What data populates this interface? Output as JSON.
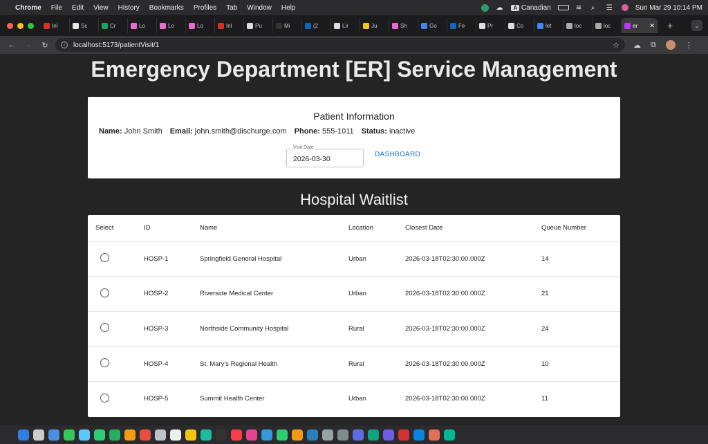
{
  "menubar": {
    "app": "Chrome",
    "items": [
      "File",
      "Edit",
      "View",
      "History",
      "Bookmarks",
      "Profiles",
      "Tab",
      "Window",
      "Help"
    ],
    "keyboard": "Canadian",
    "clock": "Sun Mar 29  10:14 PM"
  },
  "tabs": [
    {
      "label": "Inl",
      "color": "#d93025"
    },
    {
      "label": "Sc",
      "color": "#e8e8e8"
    },
    {
      "label": "Cr",
      "color": "#1aa260"
    },
    {
      "label": "Lo",
      "color": "#e96ad0"
    },
    {
      "label": "Lo",
      "color": "#e96ad0"
    },
    {
      "label": "Lo",
      "color": "#e96ad0"
    },
    {
      "label": "Inl",
      "color": "#d93025"
    },
    {
      "label": "Pu",
      "color": "#dddddd"
    },
    {
      "label": "Mi",
      "color": "#333333"
    },
    {
      "label": "(2",
      "color": "#0a66c2"
    },
    {
      "label": "Lir",
      "color": "#dddddd"
    },
    {
      "label": "Ju",
      "color": "#f5c518"
    },
    {
      "label": "Sh",
      "color": "#e96ad0"
    },
    {
      "label": "Go",
      "color": "#4285f4"
    },
    {
      "label": "Fe",
      "color": "#0a66c2"
    },
    {
      "label": "Pr",
      "color": "#dddddd"
    },
    {
      "label": "Co",
      "color": "#dddddd"
    },
    {
      "label": "let",
      "color": "#4285f4"
    },
    {
      "label": "loc",
      "color": "#aaaaaa"
    },
    {
      "label": "loc",
      "color": "#aaaaaa"
    }
  ],
  "active_tab": {
    "label": "er",
    "color": "#bd34fe"
  },
  "address": {
    "url": "localhost:5173/patientVisit/1"
  },
  "page": {
    "title": "Emergency Department [ER] Service Management",
    "patient": {
      "heading": "Patient Information",
      "name_label": "Name:",
      "name": "John Smith",
      "email_label": "Email:",
      "email": "john.smith@dischurge.com",
      "phone_label": "Phone:",
      "phone": "555-1011",
      "status_label": "Status:",
      "status": "inactive",
      "visit_date_label": "Visit Date",
      "visit_date": "2026-03-30",
      "dashboard_link": "DASHBOARD"
    },
    "waitlist_title": "Hospital Waitlist",
    "table": {
      "columns": [
        "Select",
        "ID",
        "Name",
        "Location",
        "Closest Date",
        "Queue Number"
      ],
      "rows": [
        {
          "id": "HOSP-1",
          "name": "Springfield General Hospital",
          "location": "Urban",
          "date": "2026-03-18T02:30:00.000Z",
          "queue": "14"
        },
        {
          "id": "HOSP-2",
          "name": "Riverside Medical Center",
          "location": "Urban",
          "date": "2026-03-18T02:30:00.000Z",
          "queue": "21"
        },
        {
          "id": "HOSP-3",
          "name": "Northside Community Hospital",
          "location": "Rural",
          "date": "2026-03-18T02:30:00.000Z",
          "queue": "24"
        },
        {
          "id": "HOSP-4",
          "name": "St. Mary's Regional Health",
          "location": "Rural",
          "date": "2026-03-18T02:30:00.000Z",
          "queue": "10"
        },
        {
          "id": "HOSP-5",
          "name": "Summit Health Center",
          "location": "Urban",
          "date": "2026-03-18T02:30:00.000Z",
          "queue": "11"
        }
      ]
    }
  },
  "colors": {
    "link": "#1976d2",
    "page_bg": "#242424",
    "card_bg": "#ffffff"
  }
}
